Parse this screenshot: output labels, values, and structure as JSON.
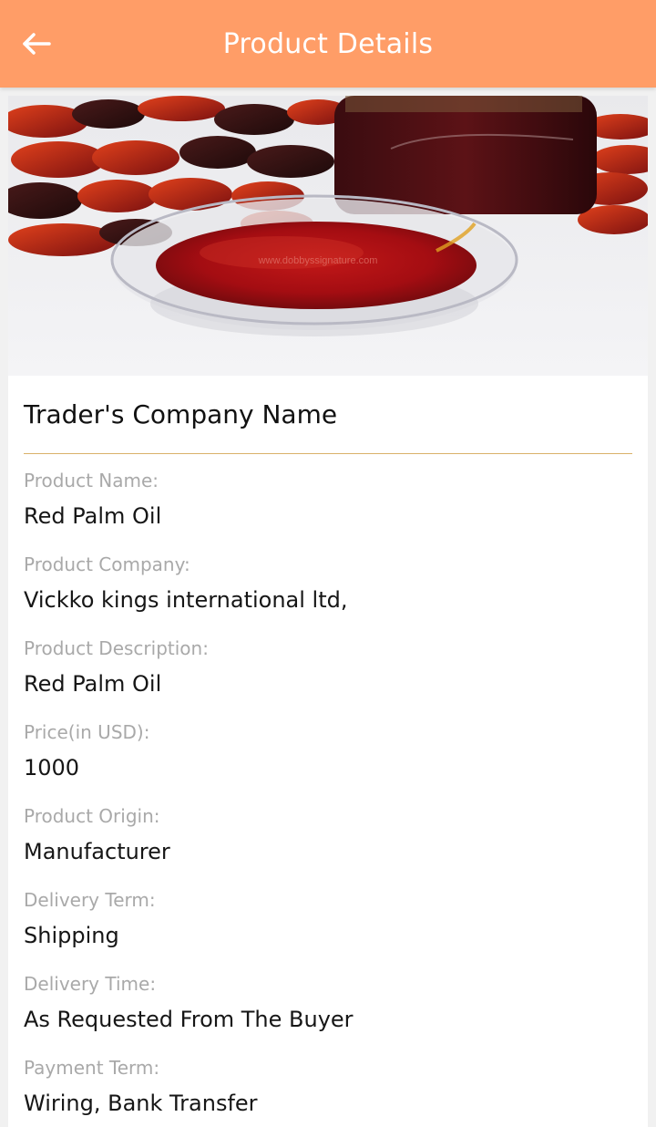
{
  "header": {
    "title": "Product Details",
    "back_icon": "arrow-left-icon",
    "background": "#ff9d67"
  },
  "product": {
    "image_watermark": "www.dobbyssignature.com",
    "company_heading": "Trader's Company Name",
    "fields": [
      {
        "label": "Product Name:",
        "value": "Red Palm Oil"
      },
      {
        "label": "Product Company:",
        "value": "Vickko kings international ltd,"
      },
      {
        "label": "Product Description:",
        "value": "Red Palm Oil"
      },
      {
        "label": "Price(in USD):",
        "value": "1000"
      },
      {
        "label": "Product Origin:",
        "value": "Manufacturer"
      },
      {
        "label": "Delivery Term:",
        "value": "Shipping"
      },
      {
        "label": "Delivery Time:",
        "value": "As Requested From The Buyer"
      },
      {
        "label": "Payment Term:",
        "value": "Wiring, Bank Transfer"
      }
    ]
  }
}
